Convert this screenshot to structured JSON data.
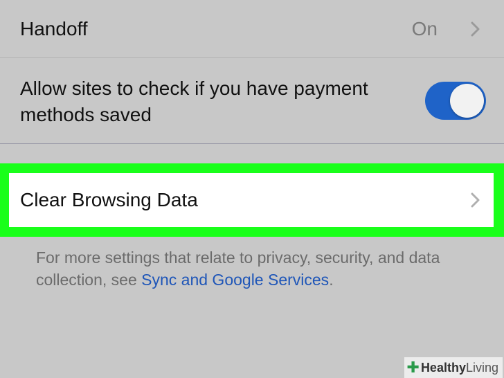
{
  "settings": {
    "handoff": {
      "label": "Handoff",
      "value": "On"
    },
    "payment": {
      "label": "Allow sites to check if you have payment methods saved",
      "toggle_on": true
    },
    "clear_browsing": {
      "label": "Clear Browsing Data"
    }
  },
  "footer": {
    "text_before": "For more settings that relate to privacy, security, and data collection, see ",
    "link": "Sync and Google Services",
    "text_after": "."
  },
  "watermark": {
    "brand_bold": "Healthy",
    "brand_light": "Living"
  },
  "colors": {
    "highlight": "#19ff1a",
    "toggle_on": "#1f63c8",
    "link": "#1f56b8"
  }
}
